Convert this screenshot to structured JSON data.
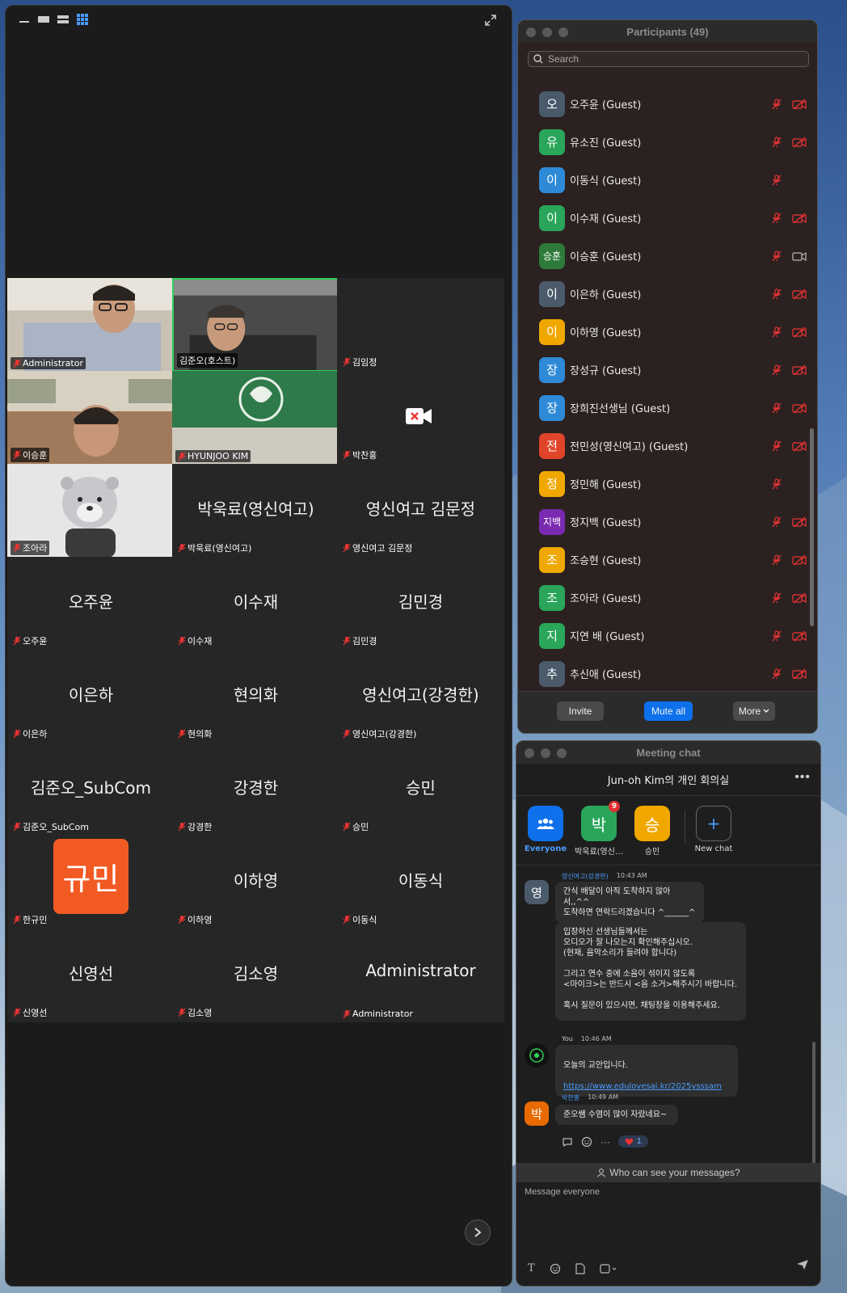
{
  "video": {
    "tiles": [
      {
        "big": "",
        "tag": "Administrator"
      },
      {
        "big": "",
        "tag": "김준오(호스트)"
      },
      {
        "big": "",
        "tag": "김임정"
      },
      {
        "big": "",
        "tag": "이승훈"
      },
      {
        "big": "",
        "tag": "HYUNJOO KIM"
      },
      {
        "big": "",
        "tag": "박찬홍"
      },
      {
        "big": "",
        "tag": "조아라"
      },
      {
        "big": "박욱료(영신여고)",
        "tag": "박욱료(영신여고)"
      },
      {
        "big": "영신여고 김문정",
        "tag": "영신여고 김문정"
      },
      {
        "big": "오주윤",
        "tag": "오주윤"
      },
      {
        "big": "이수재",
        "tag": "이수재"
      },
      {
        "big": "김민경",
        "tag": "김민경"
      },
      {
        "big": "이은하",
        "tag": "이은하"
      },
      {
        "big": "현의화",
        "tag": "현의화"
      },
      {
        "big": "영신여고(강경한)",
        "tag": "영신여고(강경한)"
      },
      {
        "big": "김준오_SubCom",
        "tag": "김준오_SubCom"
      },
      {
        "big": "강경한",
        "tag": "강경한"
      },
      {
        "big": "승민",
        "tag": "승민"
      },
      {
        "big": "",
        "tag": "한규민",
        "avatar": "규민"
      },
      {
        "big": "이하영",
        "tag": "이하영"
      },
      {
        "big": "이동식",
        "tag": "이동식"
      },
      {
        "big": "신영선",
        "tag": "신영선"
      },
      {
        "big": "김소영",
        "tag": "김소영"
      },
      {
        "big": "Administrator",
        "tag": "Administrator"
      }
    ]
  },
  "participants": {
    "title": "Participants (49)",
    "search_placeholder": "Search",
    "list": [
      {
        "initial": "오",
        "name": "오주윤 (Guest)",
        "color": "#4a5a6a",
        "video_off": true
      },
      {
        "initial": "유",
        "name": "유소진 (Guest)",
        "color": "#2aa65a",
        "video_off": true
      },
      {
        "initial": "이",
        "name": "이동식 (Guest)",
        "color": "#2e8ad6",
        "video_off": false,
        "no_video_icon": true
      },
      {
        "initial": "이",
        "name": "이수재 (Guest)",
        "color": "#2aa65a",
        "video_off": true
      },
      {
        "initial": "승훈",
        "name": "이승훈 (Guest)",
        "color": "#2e7a3a",
        "video_off": false
      },
      {
        "initial": "이",
        "name": "이은하 (Guest)",
        "color": "#4a5a6a",
        "video_off": true
      },
      {
        "initial": "이",
        "name": "이하영 (Guest)",
        "color": "#f0a800",
        "video_off": true
      },
      {
        "initial": "장",
        "name": "장성규 (Guest)",
        "color": "#2e8ad6",
        "video_off": true
      },
      {
        "initial": "장",
        "name": "장희진선생님 (Guest)",
        "color": "#2e8ad6",
        "video_off": true
      },
      {
        "initial": "전",
        "name": "전민성(영신여고) (Guest)",
        "color": "#e0452a",
        "video_off": true
      },
      {
        "initial": "정",
        "name": "정민해 (Guest)",
        "color": "#f0a800",
        "video_off": false,
        "no_video_icon": true
      },
      {
        "initial": "지백",
        "name": "정지백 (Guest)",
        "color": "#7a2ab0",
        "video_off": true
      },
      {
        "initial": "조",
        "name": "조승현 (Guest)",
        "color": "#f0a800",
        "video_off": true
      },
      {
        "initial": "조",
        "name": "조아라 (Guest)",
        "color": "#2aa65a",
        "video_off": true
      },
      {
        "initial": "지",
        "name": "지연 배 (Guest)",
        "color": "#2aa65a",
        "video_off": true
      },
      {
        "initial": "추",
        "name": "추신애 (Guest)",
        "color": "#4a5a6a",
        "video_off": true
      }
    ],
    "footer": {
      "invite": "Invite",
      "mute_all": "Mute all",
      "more": "More"
    }
  },
  "chat": {
    "title": "Meeting chat",
    "meeting_name": "Jun-oh Kim의 개인 회의실",
    "recipients": [
      {
        "label": "Everyone",
        "initial": "",
        "color": "#0e71eb",
        "selected": true
      },
      {
        "label": "박욱료(영신…",
        "initial": "박",
        "color": "#2aa65a",
        "badge": "9"
      },
      {
        "label": "승민",
        "initial": "승",
        "color": "#f0a800"
      },
      {
        "label": "New chat",
        "initial": "+",
        "color": "#1e1e1e"
      }
    ],
    "messages": [
      {
        "initial": "영",
        "color": "#4a5a6a",
        "sender": "영신여고(강경한)",
        "time": "10:43 AM",
        "text1": "간식 배달이 아직 도착하지 않아서,,^^\n도착하면 연락드리겠습니다 ^______^",
        "text2": "입장하신 선생님들께서는\n오디오가 잘 나오는지 확인해주십시오.\n(현재, 음악소리가 들려야 합니다)\n\n그리고 연수 중에 소음이 섞이지 않도록\n<마이크>는 반드시 <음 소거>해주시기 바랍니다.\n\n혹시 질문이 있으시면, 채팅창을 이용해주세요."
      },
      {
        "sender": "You",
        "time": "10:46 AM",
        "text": "오늘의 교안입니다.",
        "link": "https://www.edulovesai.kr/2025ysssam"
      },
      {
        "initial": "박",
        "color": "#e86a00",
        "sender": "박찬홍",
        "time": "10:49 AM",
        "text": "준오쌤 수염이 많이 자랐네요~",
        "reaction_count": "1"
      }
    ],
    "who_can_see": "Who can see your messages?",
    "input_placeholder": "Message everyone"
  }
}
